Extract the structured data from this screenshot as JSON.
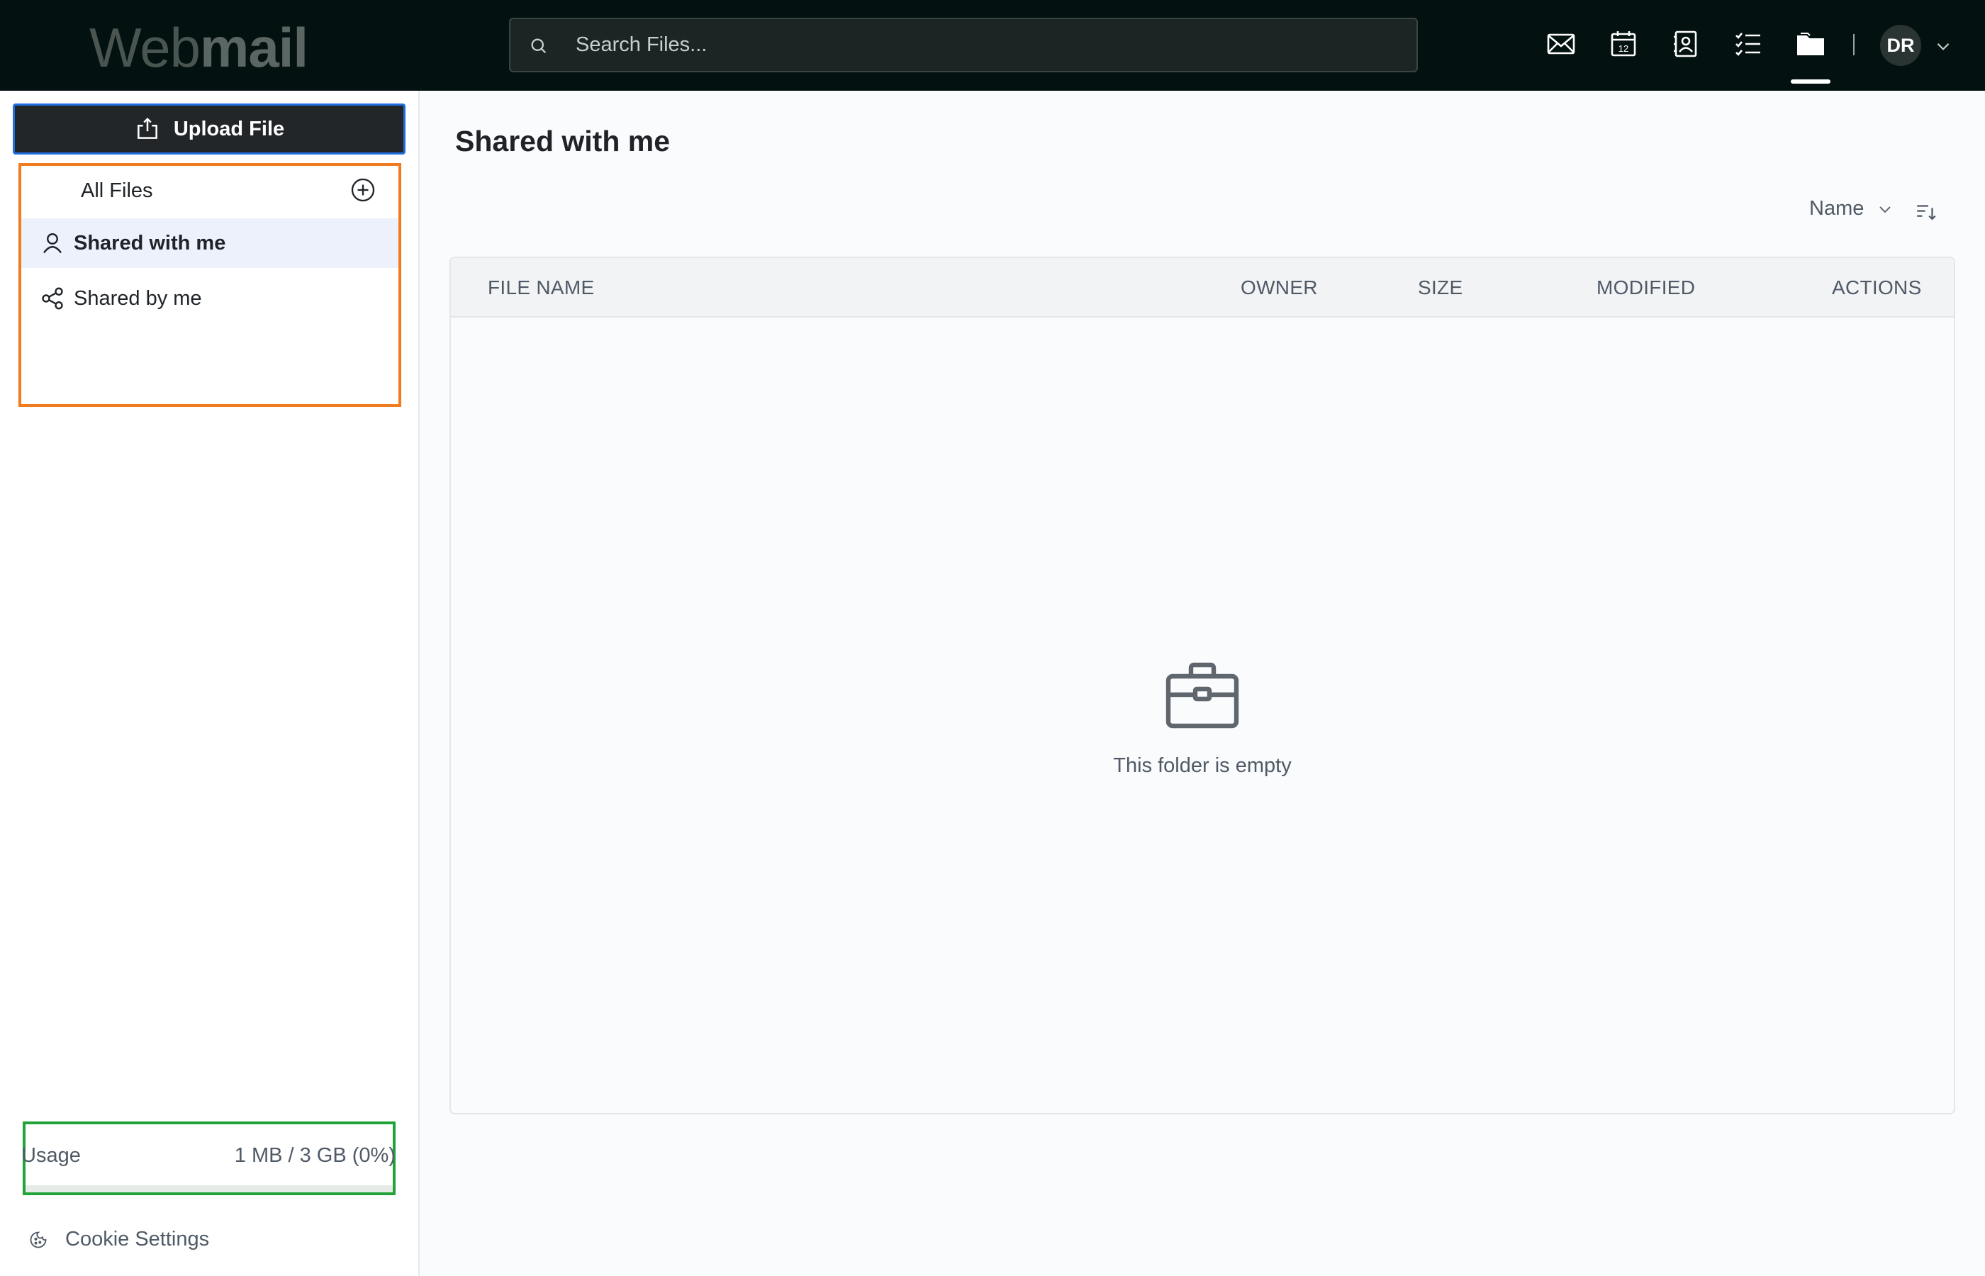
{
  "app": {
    "logo_light": "Web",
    "logo_bold": "mail"
  },
  "search": {
    "placeholder": "Search Files..."
  },
  "topnav": {
    "icons": [
      "mail-icon",
      "calendar-icon",
      "contacts-icon",
      "tasks-icon",
      "files-icon"
    ],
    "calendar_day": "12",
    "active": "files-icon",
    "avatar_initials": "DR"
  },
  "sidebar": {
    "upload_label": "Upload File",
    "items": [
      {
        "label": "All Files",
        "icon": "none",
        "active": false
      },
      {
        "label": "Shared with me",
        "icon": "user-icon",
        "active": true
      },
      {
        "label": "Shared by me",
        "icon": "share-icon",
        "active": false
      }
    ],
    "usage": {
      "label": "Usage",
      "value": "1 MB / 3 GB (0%)",
      "percent": 0
    },
    "cookie_label": "Cookie Settings"
  },
  "main": {
    "title": "Shared with me",
    "sort": {
      "label": "Name"
    },
    "columns": [
      "FILE NAME",
      "OWNER",
      "SIZE",
      "MODIFIED",
      "ACTIONS"
    ],
    "rows": [],
    "empty_text": "This folder is empty"
  },
  "colors": {
    "topbar_bg": "#031210",
    "accent_upload_border": "#1f6fe0",
    "nav_highlight_border": "#f17b1f",
    "usage_highlight_border": "#22a33a",
    "active_nav_bg": "#edf1fb"
  }
}
